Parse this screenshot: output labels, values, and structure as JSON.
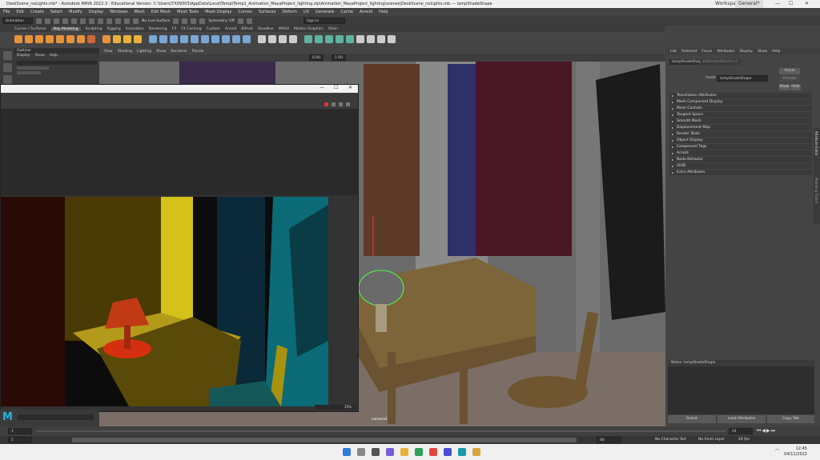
{
  "window": {
    "title": "DeskScene_noLights.mb* - Autodesk MAYA 2022.3 - Educational Version: C:\\Users\\TX09303\\AppData\\Local\\Temp\\Temp1_Animation_MayaProject_lighting.zip\\Animation_MayaProject_lighting\\scenes\\DeskScene_noLights.mb  ---  lampShadeShape",
    "workspace_label": "Workspace:",
    "workspace_value": "General*"
  },
  "menubar": [
    "File",
    "Edit",
    "Create",
    "Select",
    "Modify",
    "Display",
    "Windows",
    "Mesh",
    "Edit Mesh",
    "Mesh Tools",
    "Mesh Display",
    "Curves",
    "Surfaces",
    "Deform",
    "UV",
    "Generate",
    "Cache",
    "Arnold",
    "Help"
  ],
  "statusline": {
    "mode": "Animation",
    "live_surface": "No Live Surface",
    "symmetry": "Symmetry: Off",
    "sign_in": "Sign In"
  },
  "shelf_tabs": [
    "Curves / Surfaces",
    "Poly Modeling",
    "Sculpting",
    "Rigging",
    "Animation",
    "Rendering",
    "FX",
    "FX Caching",
    "Custom",
    "Arnold",
    "Bifrost",
    "Deadline",
    "MASH",
    "Motion Graphics",
    "XGen"
  ],
  "shelf_active": "Poly Modeling",
  "outliner": {
    "title": "Outliner",
    "menu": [
      "Display",
      "Show",
      "Help"
    ]
  },
  "viewport": {
    "menu": [
      "View",
      "Shading",
      "Lighting",
      "Show",
      "Renderer",
      "Panels"
    ],
    "camera_label": "camera1",
    "fields": [
      "0.00",
      "1.00"
    ]
  },
  "render_view": {
    "zoom": "25%"
  },
  "attribute_editor": {
    "menu": [
      "List",
      "Selected",
      "Focus",
      "Attributes",
      "Display",
      "Show",
      "Help"
    ],
    "tab_active": "lampShadeShape",
    "tab_other": "aiStandardSurface1",
    "focus_button": "Focus",
    "presets_button": "Presets",
    "show_button": "Show",
    "hide_button": "Hide",
    "mesh_label": "mesh:",
    "mesh_value": "lampShadeShape",
    "sections": [
      "Tessellation Attributes",
      "Mesh Component Display",
      "Mesh Controls",
      "Tangent Space",
      "Smooth Mesh",
      "Displacement Map",
      "Render Stats",
      "Object Display",
      "Component Tags",
      "Arnold",
      "Node Behavior",
      "UUID",
      "Extra Attributes"
    ],
    "notes_label": "Notes: lampShadeShape",
    "select_button": "Select",
    "load_button": "Load Attributes",
    "copy_button": "Copy Tab",
    "side_tabs": [
      "Attribute Editor",
      "Modeling Toolkit"
    ]
  },
  "timeslider": {
    "start": "1",
    "current": "24",
    "end": "48",
    "char_set": "No Character Set",
    "anim_layer": "No Anim Layer",
    "fps": "24 fps"
  },
  "taskbar": {
    "time": "12:45",
    "date": "04/11/2022"
  }
}
